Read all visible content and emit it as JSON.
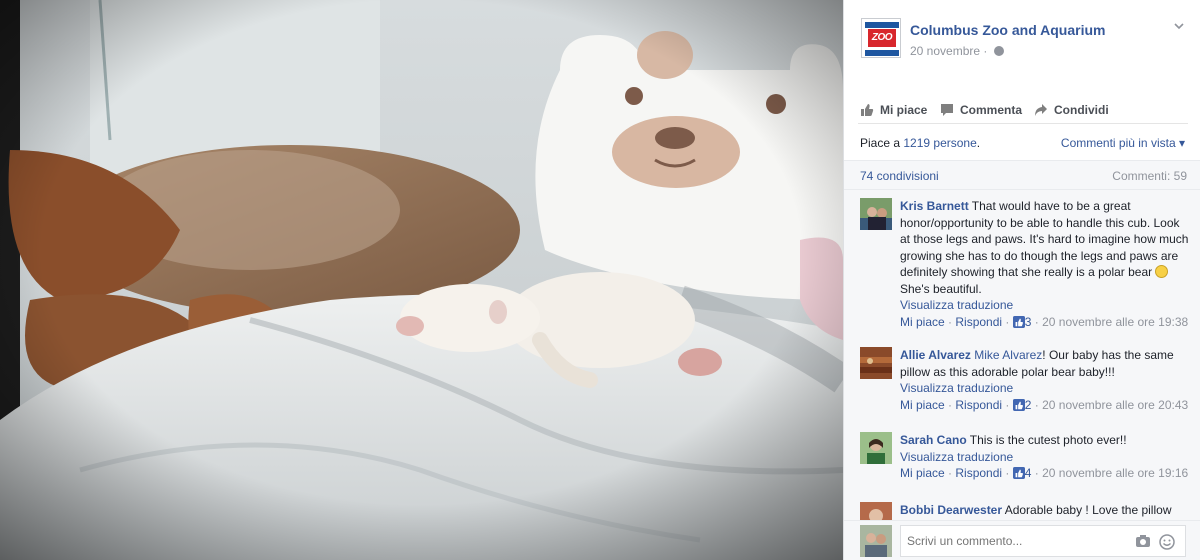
{
  "post": {
    "page_name": "Columbus Zoo and Aquarium",
    "avatar_text": "ZOO",
    "date": "20 novembre",
    "date_sep": "·"
  },
  "actions": {
    "like": "Mi piace",
    "comment": "Commenta",
    "share": "Condividi"
  },
  "likes": {
    "prefix": "Piace a ",
    "count_text": "1219 persone",
    "suffix": ".",
    "sort": "Commenti più in vista"
  },
  "shares": {
    "text": "74 condivisioni",
    "comments_count": "Commenti: 59"
  },
  "comments": [
    {
      "author": "Kris Barnett",
      "mention": "",
      "text": " That would have to be a great honor/opportunity to be able to handle this cub. Look at those legs and paws. It's hard to imagine how much growing she has to do though the legs and paws are definitely showing that she really is a polar bear ",
      "text_after_emoji": " She's beautiful.",
      "translate": "Visualizza traduzione",
      "like": "Mi piace",
      "reply": "Rispondi",
      "likes": "3",
      "time": "20 novembre alle ore 19:38"
    },
    {
      "author": "Allie Alvarez",
      "mention": "Mike Alvarez",
      "text": "! Our baby has the same pillow as this adorable polar bear baby!!!",
      "translate": "Visualizza traduzione",
      "like": "Mi piace",
      "reply": "Rispondi",
      "likes": "2",
      "time": "20 novembre alle ore 20:43"
    },
    {
      "author": "Sarah Cano",
      "mention": "",
      "text": " This is the cutest photo ever!!",
      "translate": "Visualizza traduzione",
      "like": "Mi piace",
      "reply": "Rispondi",
      "likes": "4",
      "time": "20 novembre alle ore 19:16"
    },
    {
      "author": "Bobbi Dearwester",
      "mention": "",
      "text": " Adorable baby ! Love the pillow"
    }
  ],
  "composer": {
    "placeholder": "Scrivi un commento..."
  },
  "colors": {
    "link": "#365899",
    "meta": "#90949c",
    "panel_bg": "#ffffff"
  }
}
